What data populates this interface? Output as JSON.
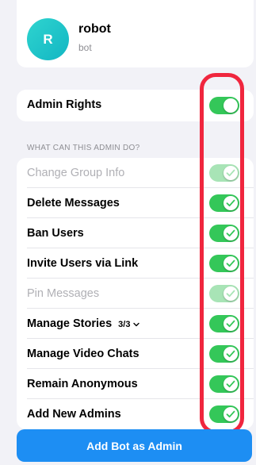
{
  "profile": {
    "initial": "R",
    "name": "robot",
    "subtitle": "bot"
  },
  "admin_rights": {
    "label": "Admin Rights",
    "enabled": true
  },
  "section_header": "WHAT CAN THIS ADMIN DO?",
  "permissions": [
    {
      "label": "Change Group Info",
      "enabled": true,
      "disabled": true
    },
    {
      "label": "Delete Messages",
      "enabled": true,
      "disabled": false
    },
    {
      "label": "Ban Users",
      "enabled": true,
      "disabled": false
    },
    {
      "label": "Invite Users via Link",
      "enabled": true,
      "disabled": false
    },
    {
      "label": "Pin Messages",
      "enabled": true,
      "disabled": true
    },
    {
      "label": "Manage Stories",
      "extra": "3/3",
      "enabled": true,
      "disabled": false
    },
    {
      "label": "Manage Video Chats",
      "enabled": true,
      "disabled": false
    },
    {
      "label": "Remain Anonymous",
      "enabled": true,
      "disabled": false
    },
    {
      "label": "Add New Admins",
      "enabled": true,
      "disabled": false
    }
  ],
  "cta_label": "Add Bot as Admin",
  "colors": {
    "toggle_on": "#34c759",
    "toggle_disabled": "#a8e4b6",
    "cta": "#1d8ef3",
    "highlight": "#f0263e"
  }
}
